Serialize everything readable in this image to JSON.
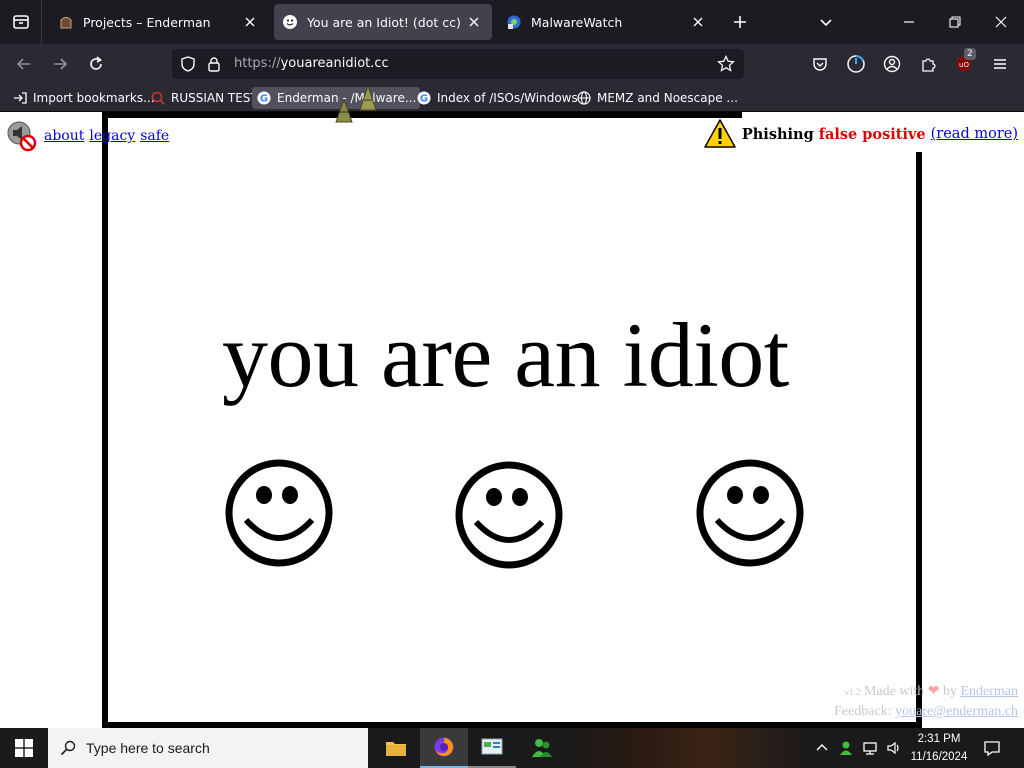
{
  "browser": {
    "tabs": [
      {
        "title": "Projects – Enderman",
        "active": false
      },
      {
        "title": "You are an Idiot! (dot cc)",
        "active": true
      },
      {
        "title": "MalwareWatch",
        "active": false
      }
    ],
    "url_scheme": "https://",
    "url_host": "youareanidiot.cc",
    "extension_badge": "2",
    "bookmarks": [
      {
        "label": "Import bookmarks...",
        "icon": "import-icon"
      },
      {
        "label": "RUSSIAN TEST",
        "icon": "magnifier-icon"
      },
      {
        "label": "Enderman - /Malware...",
        "icon": "google-icon"
      },
      {
        "label": "Index of /ISOs/Windows",
        "icon": "google-icon"
      },
      {
        "label": "MEMZ and Noescape ...",
        "icon": "globe-icon"
      }
    ]
  },
  "page": {
    "top_links": [
      "about",
      "legacy",
      "safe"
    ],
    "notice": {
      "prefix": "Phishing",
      "highlight": "false positive",
      "link": "(read more)"
    },
    "headline": "you are an idiot",
    "smiley_count": 3,
    "footer": {
      "version": "v1.2",
      "made_with": "Made with",
      "by": "by",
      "author": "Enderman",
      "feedback_label": "Feedback:",
      "feedback_email": "youare@enderman.ch"
    }
  },
  "taskbar": {
    "search_placeholder": "Type here to search",
    "time": "2:31 PM",
    "date": "11/16/2024"
  },
  "colors": {
    "tabstrip": "#1c1b22",
    "toolbar": "#2b2a33",
    "active_tab": "#42414d",
    "link": "#0000ee",
    "warning_red": "#e00000",
    "taskbar": "#1a1a1a"
  }
}
